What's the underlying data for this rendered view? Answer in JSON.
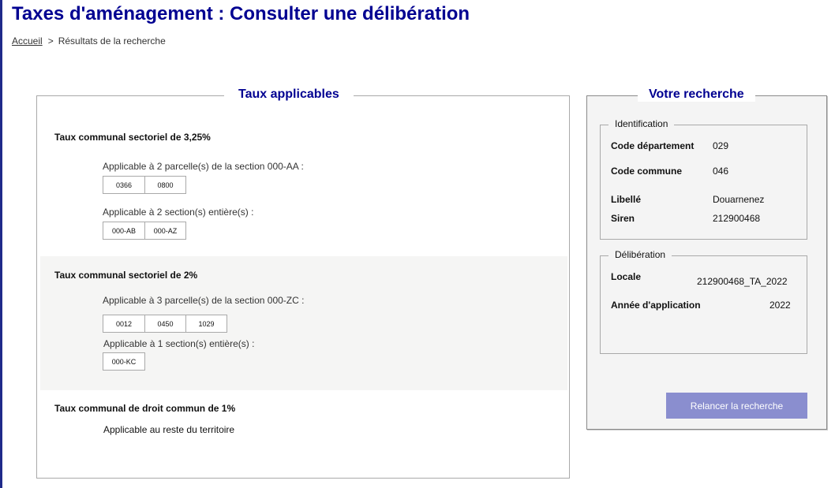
{
  "page": {
    "title": "Taxes d'aménagement : Consulter une délibération"
  },
  "breadcrumb": {
    "home": "Accueil",
    "separator": ">",
    "current": "Résultats de la recherche"
  },
  "taux_panel": {
    "title": "Taux applicables",
    "rates": [
      {
        "title": "Taux communal sectoriel de 3,25%",
        "parcels_text": "Applicable à 2 parcelle(s) de la section 000-AA :",
        "parcels": [
          "0366",
          "0800"
        ],
        "sections_text": "Applicable à 2 section(s) entière(s) :",
        "sections": [
          "000-AB",
          "000-AZ"
        ]
      },
      {
        "title": "Taux communal sectoriel de 2%",
        "parcels_text": "Applicable à 3 parcelle(s) de la section 000-ZC :",
        "parcels": [
          "0012",
          "0450",
          "1029"
        ],
        "sections_text": "Applicable à 1 section(s) entière(s) :",
        "sections": [
          "000-KC"
        ]
      },
      {
        "title": "Taux communal de droit commun de 1%",
        "rest_text": "Applicable au reste du territoire"
      }
    ]
  },
  "search_panel": {
    "title": "Votre recherche",
    "identification": {
      "legend": "Identification",
      "code_departement_label": "Code département",
      "code_departement_value": "029",
      "code_commune_label": "Code commune",
      "code_commune_value": "046",
      "libelle_label": "Libellé",
      "libelle_value": "Douarnenez",
      "siren_label": "Siren",
      "siren_value": "212900468"
    },
    "deliberation": {
      "legend": "Délibération",
      "locale_label": "Locale",
      "locale_value": "212900468_TA_2022",
      "annee_label": "Année d'application",
      "annee_value": "2022"
    },
    "relaunch_label": "Relancer la recherche"
  },
  "colors": {
    "title_blue": "#000091",
    "button_purple": "#8a8ecf",
    "alt_row": "#f5f5f4"
  }
}
